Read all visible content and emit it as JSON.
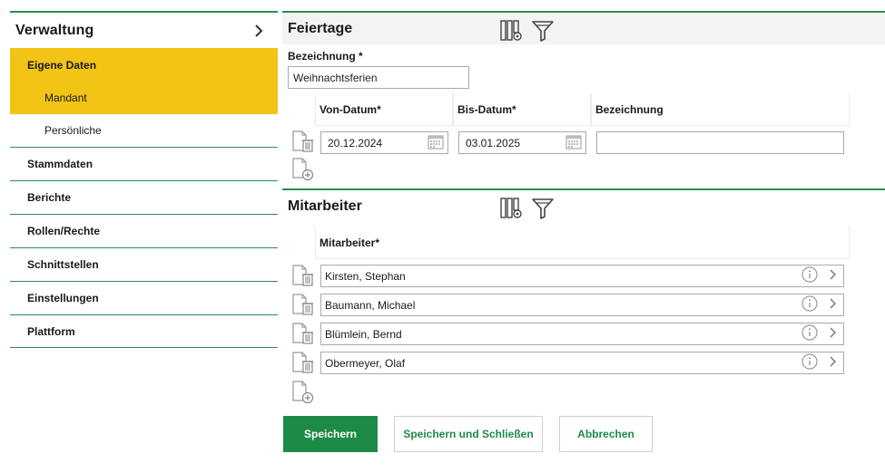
{
  "sidebar": {
    "title": "Verwaltung",
    "collapse_icon": "chevron-right-icon",
    "groups": [
      {
        "label": "Eigene Daten",
        "active": true,
        "children": [
          {
            "label": "Mandant",
            "active": true
          },
          {
            "label": "Persönliche",
            "active": false
          }
        ]
      }
    ],
    "items": [
      {
        "label": "Stammdaten"
      },
      {
        "label": "Berichte"
      },
      {
        "label": "Rollen/Rechte"
      },
      {
        "label": "Schnittstellen"
      },
      {
        "label": "Einstellungen"
      },
      {
        "label": "Plattform"
      }
    ]
  },
  "feiertage": {
    "title": "Feiertage",
    "icons": [
      "column-settings-icon",
      "filter-icon"
    ],
    "bezeichnung_label": "Bezeichnung *",
    "bezeichnung_value": "Weihnachtsferien",
    "columns": [
      "Von-Datum*",
      "Bis-Datum*",
      "Bezeichnung"
    ],
    "rows": [
      {
        "von": "20.12.2024",
        "bis": "03.01.2025",
        "bezeichnung": ""
      }
    ]
  },
  "mitarbeiter": {
    "title": "Mitarbeiter",
    "icons": [
      "column-settings-icon",
      "filter-icon"
    ],
    "columns": [
      "Mitarbeiter*"
    ],
    "rows": [
      {
        "name": "Kirsten, Stephan"
      },
      {
        "name": "Baumann, Michael"
      },
      {
        "name": "Blümlein, Bernd"
      },
      {
        "name": "Obermeyer, Olaf"
      }
    ]
  },
  "buttons": {
    "save": "Speichern",
    "save_close": "Speichern und Schließen",
    "cancel": "Abbrechen"
  },
  "colors": {
    "accent_green": "#1e8a48",
    "active_yellow": "#f2c416",
    "divider_green": "#2e8b57"
  }
}
